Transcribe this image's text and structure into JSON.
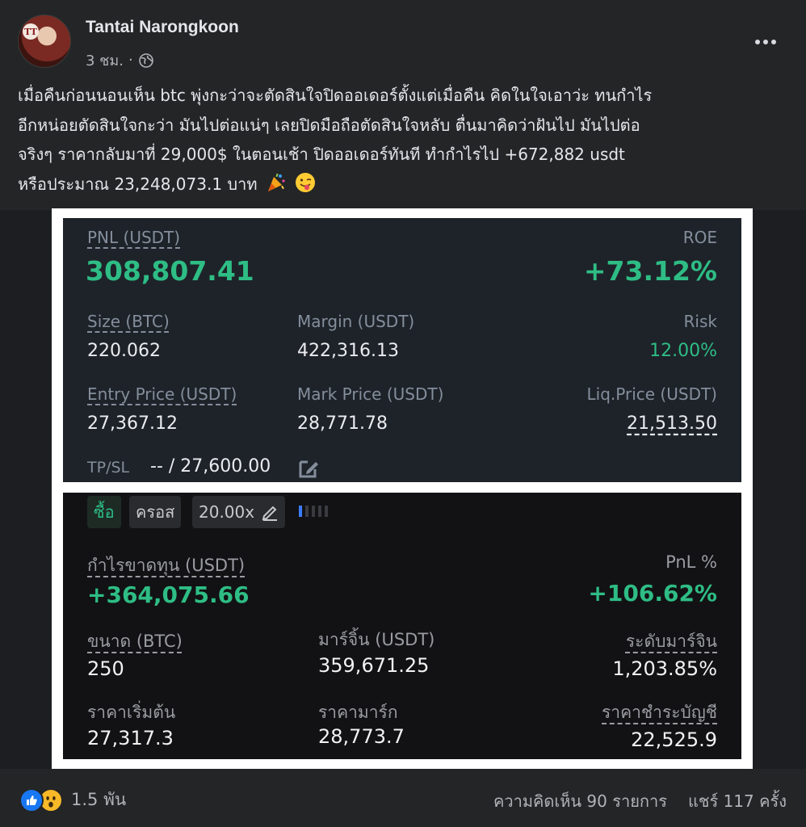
{
  "post": {
    "author": "Tantai Narongkoon",
    "time": "3 ชม.",
    "separator": "·",
    "avatar_mark": "TT",
    "text_lines": [
      "เมื่อคืนก่อนนอนเห็น btc พุ่งกะว่าจะตัดสินใจปิดออเดอร์ตั้งแต่เมื่อคืน คิดในใจเอาว่ะ ทนกำไร",
      "อีกหน่อยตัดสินใจกะว่า มันไปต่อแน่ๆ เลยปิดมือถือตัดสินใจหลับ ตื่นมาคิดว่าฝันไป มันไปต่อ",
      "จริงๆ ราคากลับมาที่ 29,000$ ในตอนเช้า ปิดออเดอร์ทันที ทำกำไรไป  +672,882 usdt",
      "หรือประมาณ 23,248,073.1 บาท"
    ]
  },
  "panel1": {
    "pnl_label": "PNL (USDT)",
    "pnl_value": "308,807.41",
    "roe_label": "ROE",
    "roe_value": "+73.12%",
    "size_label": "Size (BTC)",
    "size_value": "220.062",
    "margin_label": "Margin (USDT)",
    "margin_value": "422,316.13",
    "risk_label": "Risk",
    "risk_value": "12.00%",
    "entry_label": "Entry Price (USDT)",
    "entry_value": "27,367.12",
    "mark_label": "Mark Price (USDT)",
    "mark_value": "28,771.78",
    "liq_label": "Liq.Price (USDT)",
    "liq_value": "21,513.50",
    "tpsl_label": "TP/SL",
    "tpsl_value": "-- / 27,600.00"
  },
  "panel2": {
    "buy_label": "ซื้อ",
    "cross_label": "ครอส",
    "leverage_label": "20.00x",
    "pnl_label": "กำไรขาดทุน (USDT)",
    "pnl_value": "+364,075.66",
    "pnl_pct_label": "PnL %",
    "pnl_pct_value": "+106.62%",
    "size_label": "ขนาด (BTC)",
    "size_value": "250",
    "margin_label": "มาร์จิ้น (USDT)",
    "margin_value": "359,671.25",
    "margin_level_label": "ระดับมาร์จิน",
    "margin_level_value": "1,203.85%",
    "entry_label": "ราคาเริ่มต้น",
    "entry_value": "27,317.3",
    "mark_label": "ราคามาร์ก",
    "mark_value": "28,773.7",
    "liq_label": "ราคาชำระบัญชี",
    "liq_value": "22,525.9"
  },
  "footer": {
    "reaction_count": "1.5 พัน",
    "comments": "ความคิดเห็น 90 รายการ",
    "shares": "แชร์ 117 ครั้ง"
  },
  "colors": {
    "background": "#242526",
    "profit_green": "#2ebd85",
    "like_blue": "#1877f2",
    "wow_yellow": "#f7b928"
  },
  "icons": [
    "globe-icon",
    "more-icon",
    "party-popper-icon",
    "tongue-wink-icon",
    "edit-icon",
    "pencil-icon",
    "like-icon",
    "wow-icon"
  ]
}
